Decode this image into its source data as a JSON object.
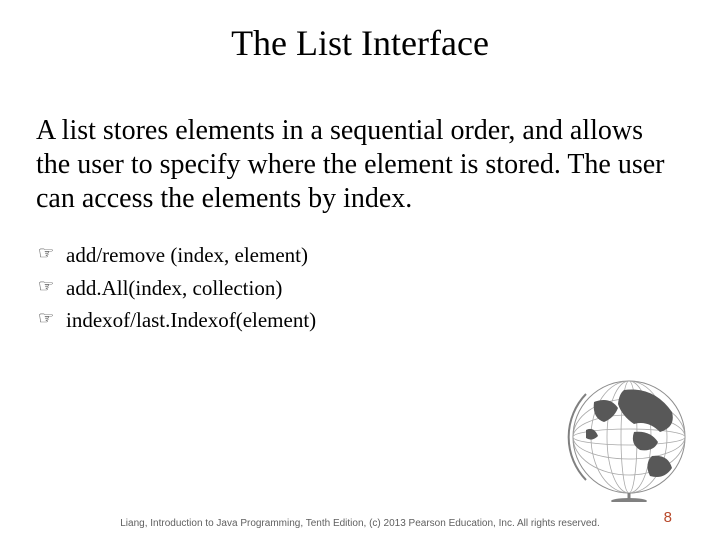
{
  "title": "The List Interface",
  "body": "A list stores elements in a sequential order, and allows the user to specify where the element is stored. The user can access the elements by index.",
  "bullets": [
    "add/remove (index, element)",
    "add.All(index, collection)",
    "indexof/last.Indexof(element)"
  ],
  "bullet_marker": "☞",
  "footer": "Liang, Introduction to Java Programming, Tenth Edition, (c) 2013 Pearson Education, Inc. All rights reserved.",
  "page_number": "8"
}
